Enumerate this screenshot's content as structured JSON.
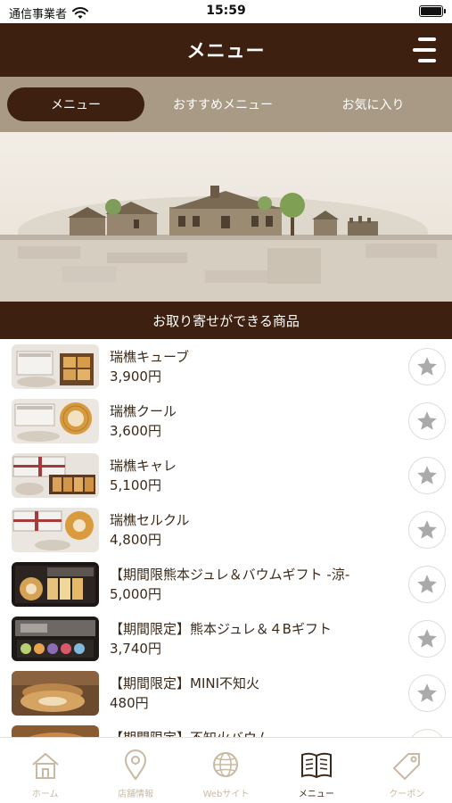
{
  "status_bar": {
    "carrier": "通信事業者",
    "time": "15:59"
  },
  "header": {
    "title": "メニュー",
    "menu_icon": "hamburger-icon"
  },
  "tabs": [
    {
      "label": "メニュー",
      "active": true
    },
    {
      "label": "おすすめメニュー",
      "active": false
    },
    {
      "label": "お気に入り",
      "active": false
    }
  ],
  "banner": {
    "icon": "townscape-illustration"
  },
  "section": {
    "title": "お取り寄せができる商品"
  },
  "products": [
    {
      "name": "瑞樵キューブ",
      "price": "3,900円",
      "favorite_icon": "star-icon"
    },
    {
      "name": "瑞樵クール",
      "price": "3,600円",
      "favorite_icon": "star-icon"
    },
    {
      "name": "瑞樵キャレ",
      "price": "5,100円",
      "favorite_icon": "star-icon"
    },
    {
      "name": "瑞樵セルクル",
      "price": "4,800円",
      "favorite_icon": "star-icon"
    },
    {
      "name": "【期間限熊本ジュレ＆バウムギフト -涼-",
      "price": "5,000円",
      "favorite_icon": "star-icon"
    },
    {
      "name": "【期間限定】熊本ジュレ＆４Bギフト",
      "price": "3,740円",
      "favorite_icon": "star-icon"
    },
    {
      "name": "【期間限定】MINI不知火",
      "price": "480円",
      "favorite_icon": "star-icon"
    },
    {
      "name": "【期間限定】不知火バウム",
      "price": "",
      "favorite_icon": "star-icon"
    }
  ],
  "bottom_nav": [
    {
      "label": "ホーム",
      "icon": "home-icon",
      "active": false
    },
    {
      "label": "店舗情報",
      "icon": "map-pin-icon",
      "active": false
    },
    {
      "label": "Webサイト",
      "icon": "globe-icon",
      "active": false
    },
    {
      "label": "メニュー",
      "icon": "book-icon",
      "active": true
    },
    {
      "label": "クーポン",
      "icon": "tag-icon",
      "active": false
    }
  ],
  "colors": {
    "brand_dark": "#3d2010",
    "tab_bg": "#a89a85",
    "nav_inactive": "#c9b9a2",
    "star": "#aaaaaa"
  }
}
